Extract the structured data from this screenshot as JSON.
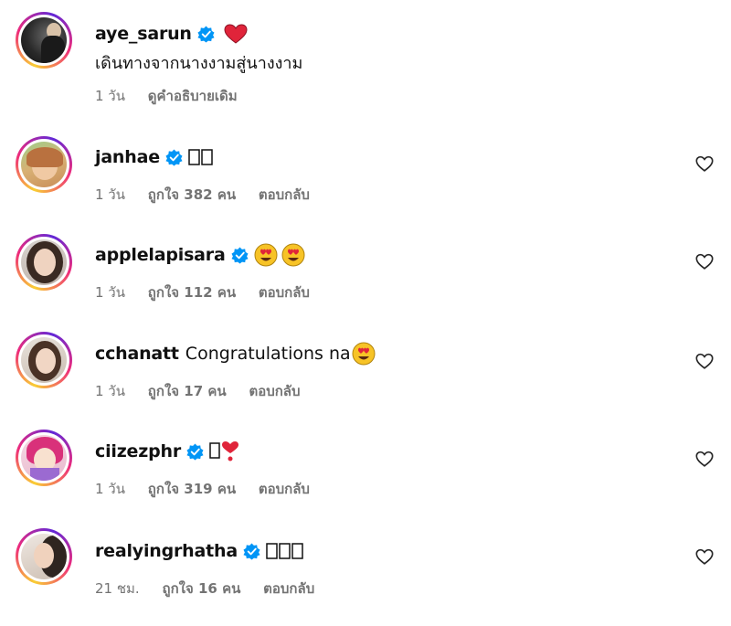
{
  "caption_comment": {
    "username": "aye_sarun",
    "text": "เดินทางจากนางงามสู่นางงาม",
    "time": "1 วัน",
    "see_original": "ดูคำอธิบายเดิม",
    "emoji": "red-heart"
  },
  "comments": [
    {
      "username": "janhae",
      "verified": true,
      "text": "",
      "time": "1 วัน",
      "likes": "ถูกใจ 382 คน",
      "reply": "ตอบกลับ"
    },
    {
      "username": "applelapisara",
      "verified": true,
      "text": "",
      "time": "1 วัน",
      "likes": "ถูกใจ 112 คน",
      "reply": "ตอบกลับ",
      "emoji": "heart-eyes x2"
    },
    {
      "username": "cchanatt",
      "verified": false,
      "text": "Congratulations na",
      "time": "1 วัน",
      "likes": "ถูกใจ 17 คน",
      "reply": "ตอบกลับ",
      "emoji": "heart-eyes"
    },
    {
      "username": "ciizezphr",
      "verified": true,
      "text": "",
      "time": "1 วัน",
      "likes": "ถูกใจ 319 คน",
      "reply": "ตอบกลับ",
      "emoji": "heart-exclamation"
    },
    {
      "username": "realyingrhatha",
      "verified": true,
      "text": "",
      "time": "21 ชม.",
      "likes": "ถูกใจ 16 คน",
      "reply": "ตอบกลับ"
    }
  ],
  "colors": {
    "verified_blue": "#0095f6",
    "meta_gray": "#737373",
    "heart_red": "#e0243a",
    "emoji_yellow": "#f7c326"
  }
}
